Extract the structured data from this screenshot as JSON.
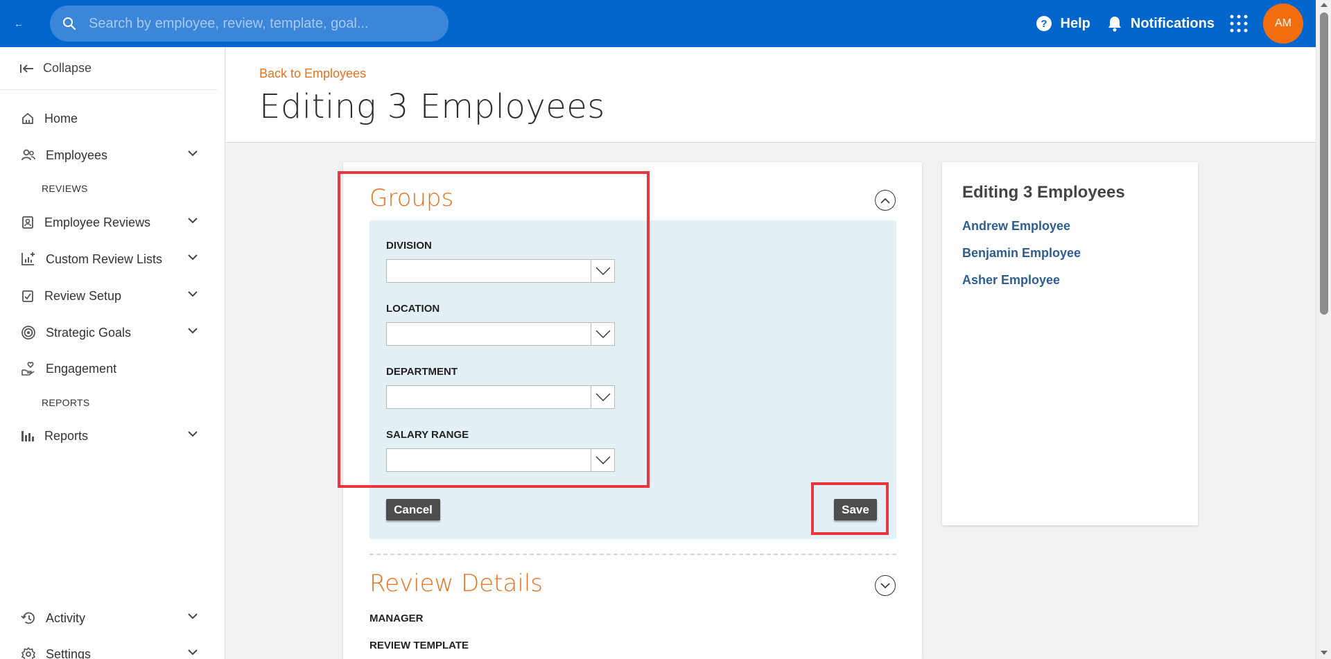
{
  "topbar": {
    "search_placeholder": "Search by employee, review, template, goal...",
    "help_label": "Help",
    "notifications_label": "Notifications",
    "avatar_initials": "AM",
    "color": "#0066cc",
    "avatar_color": "#f26d0f"
  },
  "sidebar": {
    "collapse_label": "Collapse",
    "items": [
      {
        "label": "Home",
        "icon": "home-icon"
      },
      {
        "label": "Employees",
        "icon": "people-icon"
      },
      {
        "label": "Employee Reviews",
        "icon": "review-badge-icon"
      },
      {
        "label": "Custom Review Lists",
        "icon": "chart-add-icon"
      },
      {
        "label": "Review Setup",
        "icon": "checklist-icon"
      },
      {
        "label": "Strategic Goals",
        "icon": "target-icon"
      },
      {
        "label": "Engagement",
        "icon": "hand-heart-icon"
      },
      {
        "label": "Reports",
        "icon": "bar-chart-icon"
      },
      {
        "label": "Activity",
        "icon": "history-icon"
      },
      {
        "label": "Settings",
        "icon": "gear-icon"
      }
    ],
    "sections": [
      "REVIEWS",
      "REPORTS"
    ]
  },
  "header": {
    "back_link": "Back to Employees",
    "title": "Editing 3 Employees"
  },
  "groups": {
    "title": "Groups",
    "fields": [
      {
        "label": "DIVISION",
        "value": ""
      },
      {
        "label": "LOCATION",
        "value": ""
      },
      {
        "label": "DEPARTMENT",
        "value": ""
      },
      {
        "label": "SALARY RANGE",
        "value": ""
      }
    ],
    "cancel_label": "Cancel",
    "save_label": "Save"
  },
  "review_details": {
    "title": "Review Details",
    "manager_label": "MANAGER",
    "template_label": "REVIEW TEMPLATE"
  },
  "side_panel": {
    "title": "Editing 3 Employees",
    "employees": [
      "Andrew Employee",
      "Benjamin Employee",
      "Asher Employee"
    ]
  },
  "accent_color": "#e8701f",
  "highlight_color": "#e8373e"
}
